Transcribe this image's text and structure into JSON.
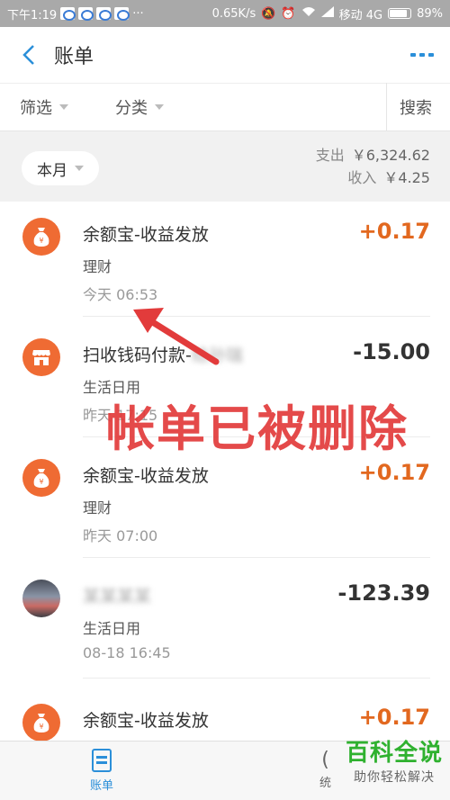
{
  "status_bar": {
    "time": "下午1:19",
    "network_speed": "0.65K/s",
    "carrier": "移动 4G",
    "battery": "89%",
    "battery_level": 0.89
  },
  "header": {
    "title": "账单",
    "back_icon": "chevron-left-icon",
    "more_icon": "more-dots-icon"
  },
  "filters": {
    "filter_label": "筛选",
    "category_label": "分类",
    "search_label": "搜索"
  },
  "summary": {
    "month_label": "本月",
    "expense_label": "支出",
    "expense_value": "￥6,324.62",
    "income_label": "收入",
    "income_value": "￥4.25"
  },
  "transactions": [
    {
      "title": "余额宝-收益发放",
      "category": "理财",
      "time": "今天  06:53",
      "amount": "+0.17",
      "type": "income",
      "icon": "money-bag-icon"
    },
    {
      "title": "扫收钱码付款-",
      "title_blurred": "给孙瑞",
      "category": "生活日用",
      "time": "昨天  17:15",
      "amount": "-15.00",
      "type": "expense",
      "icon": "shop-icon"
    },
    {
      "title": "余额宝-收益发放",
      "category": "理财",
      "time": "昨天  07:00",
      "amount": "+0.17",
      "type": "income",
      "icon": "money-bag-icon"
    },
    {
      "title_blurred": "某某某某",
      "category": "生活日用",
      "time": "08-18  16:45",
      "amount": "-123.39",
      "type": "expense",
      "icon": "user-photo"
    },
    {
      "title": "余额宝-收益发放",
      "amount": "+0.17",
      "type": "income",
      "icon": "money-bag-icon"
    }
  ],
  "annotation": {
    "text": "帐单已被删除",
    "color": "#e23b3b"
  },
  "tab_bar": {
    "bill_tab": "账单",
    "other_tab_partial": "统"
  },
  "watermark": {
    "main": "百科全说",
    "sub": "助你轻松解决"
  },
  "colors": {
    "accent": "#2b8fd9",
    "income": "#e2681f",
    "icon_orange": "#ef6b33"
  }
}
